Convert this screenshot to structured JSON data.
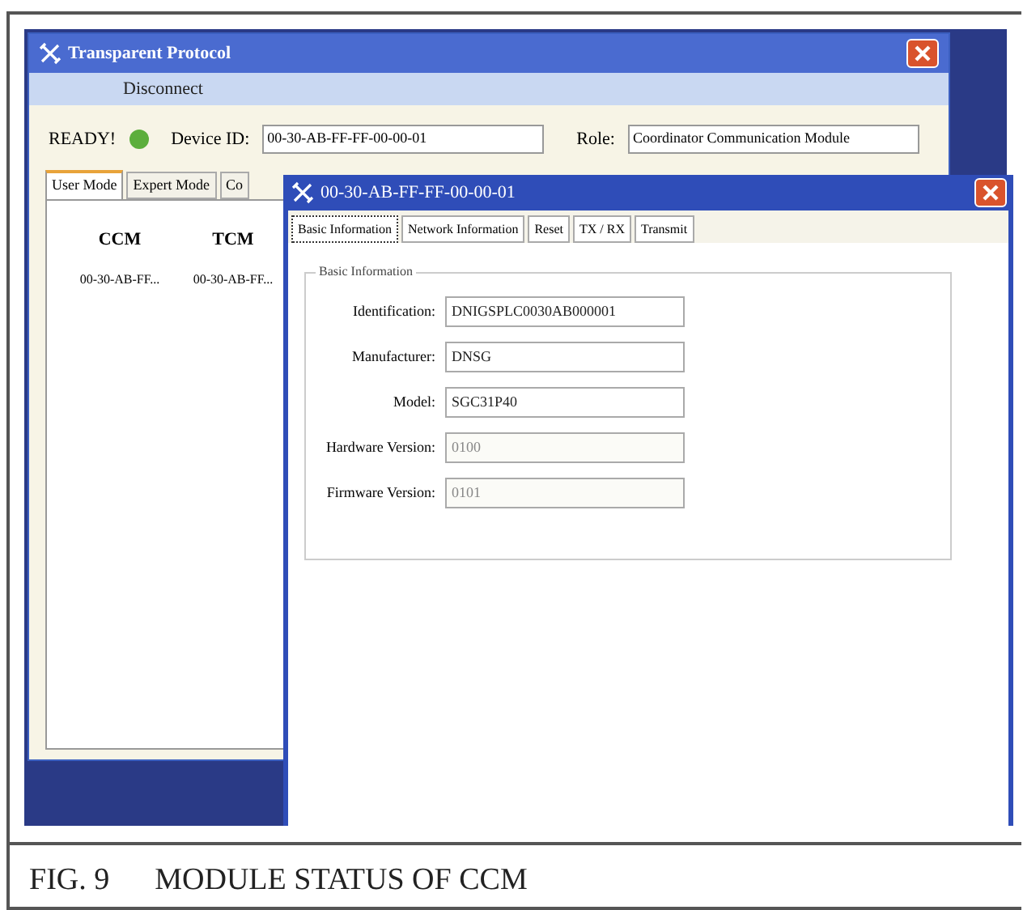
{
  "main_window": {
    "title": "Transparent Protocol",
    "menu": [
      "Disconnect"
    ],
    "status": {
      "label": "READY!",
      "ready": true
    },
    "device_id": {
      "label": "Device ID:",
      "value": "00-30-AB-FF-FF-00-00-01"
    },
    "role": {
      "label": "Role:",
      "value": "Coordinator Communication Module"
    },
    "tabs": [
      {
        "label": "User Mode",
        "selected": true
      },
      {
        "label": "Expert Mode",
        "selected": false
      },
      {
        "label": "Co",
        "selected": false
      }
    ],
    "table": {
      "columns": [
        "CCM",
        "TCM"
      ],
      "rows": [
        [
          "00-30-AB-FF...",
          "00-30-AB-FF..."
        ]
      ]
    }
  },
  "dialog": {
    "title": "00-30-AB-FF-FF-00-00-01",
    "tabs": [
      {
        "label": "Basic Information",
        "selected": true
      },
      {
        "label": "Network Information",
        "selected": false
      },
      {
        "label": "Reset",
        "selected": false
      },
      {
        "label": "TX / RX",
        "selected": false
      },
      {
        "label": "Transmit",
        "selected": false
      }
    ],
    "group": {
      "title": "Basic Information",
      "fields": [
        {
          "label": "Identification:",
          "value": "DNIGSPLC0030AB000001",
          "disabled": false
        },
        {
          "label": "Manufacturer:",
          "value": "DNSG",
          "disabled": false
        },
        {
          "label": "Model:",
          "value": "SGC31P40",
          "disabled": false
        },
        {
          "label": "Hardware Version:",
          "value": "0100",
          "disabled": true
        },
        {
          "label": "Firmware Version:",
          "value": "0101",
          "disabled": true
        }
      ]
    }
  },
  "caption": {
    "number": "FIG. 9",
    "text": "MODULE STATUS OF CCM"
  }
}
